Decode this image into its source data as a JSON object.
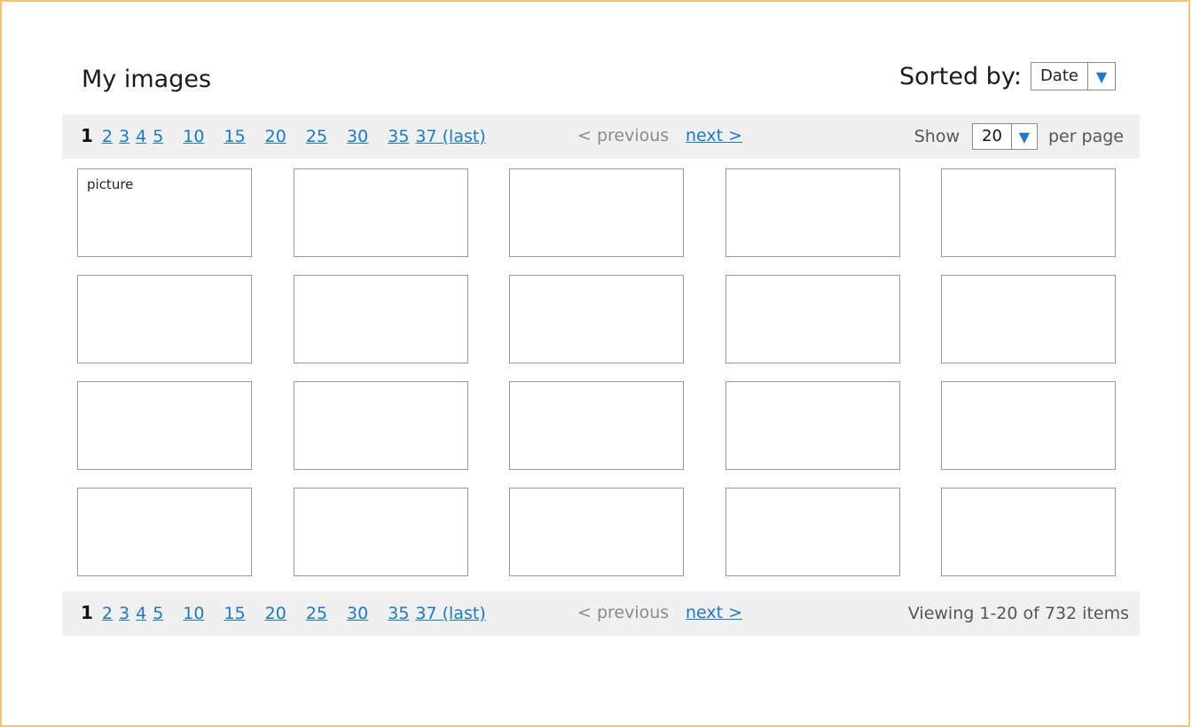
{
  "header": {
    "title": "My images",
    "sort_label": "Sorted by:",
    "sort_value": "Date"
  },
  "pagination": {
    "current": "1",
    "pages": [
      "2",
      "3",
      "4",
      "5",
      "10",
      "15",
      "20",
      "25",
      "30",
      "35",
      "37 (last)"
    ],
    "previous": "< previous",
    "next": "next >"
  },
  "per_page": {
    "show_label": "Show",
    "value": "20",
    "suffix": "per page"
  },
  "footer": {
    "viewing": "Viewing 1-20 of 732 items"
  },
  "grid": {
    "tiles": [
      {
        "label": "picture"
      },
      {
        "label": ""
      },
      {
        "label": ""
      },
      {
        "label": ""
      },
      {
        "label": ""
      },
      {
        "label": ""
      },
      {
        "label": ""
      },
      {
        "label": ""
      },
      {
        "label": ""
      },
      {
        "label": ""
      },
      {
        "label": ""
      },
      {
        "label": ""
      },
      {
        "label": ""
      },
      {
        "label": ""
      },
      {
        "label": ""
      },
      {
        "label": ""
      },
      {
        "label": ""
      },
      {
        "label": ""
      },
      {
        "label": ""
      },
      {
        "label": ""
      }
    ]
  },
  "colors": {
    "frame": "#f5c27a",
    "link": "#1a7ac8",
    "bar_bg": "#f0f0f0"
  },
  "icons": {
    "dropdown": "triangle-down-icon"
  }
}
